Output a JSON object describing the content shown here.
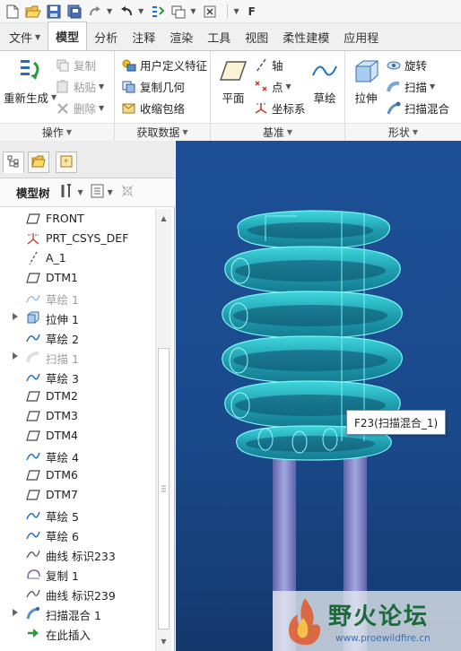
{
  "app": {
    "title_initial": "F",
    "quick_access_icons": [
      "new-icon",
      "open-icon",
      "save-icon",
      "save-copy-icon",
      "redo-icon",
      "undo-icon",
      "regenerate-icon",
      "windows-icon",
      "close-icon",
      "customize-icon"
    ]
  },
  "ribbon": {
    "tabs": [
      {
        "label": "文件",
        "dropdown": true
      },
      {
        "label": "模型",
        "active": true
      },
      {
        "label": "分析"
      },
      {
        "label": "注释"
      },
      {
        "label": "渲染"
      },
      {
        "label": "工具"
      },
      {
        "label": "视图"
      },
      {
        "label": "柔性建模"
      },
      {
        "label": "应用程"
      }
    ],
    "groups": {
      "operations": {
        "label": "操作",
        "regenerate": "重新生成",
        "copy": "复制",
        "paste": "粘贴",
        "delete": "删除"
      },
      "get_data": {
        "label": "获取数据",
        "udf": "用户定义特征",
        "copy_geom": "复制几何",
        "shrinkwrap": "收缩包络"
      },
      "datum": {
        "label": "基准",
        "plane": "平面",
        "axis": "轴",
        "point": "点",
        "csys": "坐标系",
        "sketch": "草绘"
      },
      "shapes": {
        "label": "形状",
        "extrude": "拉伸",
        "revolve": "旋转",
        "sweep": "扫描",
        "swept_blend": "扫描混合"
      }
    }
  },
  "panel": {
    "model_tree_label": "模型树",
    "items": [
      {
        "label": "FRONT",
        "icon": "datum-plane-icon",
        "expandable": false,
        "suppressed": false
      },
      {
        "label": "PRT_CSYS_DEF",
        "icon": "csys-icon",
        "expandable": false,
        "suppressed": false
      },
      {
        "label": "A_1",
        "icon": "axis-icon",
        "expandable": false,
        "suppressed": false
      },
      {
        "label": "DTM1",
        "icon": "datum-plane-icon",
        "expandable": false,
        "suppressed": false
      },
      {
        "label": "草绘 1",
        "icon": "sketch-icon",
        "expandable": false,
        "suppressed": true
      },
      {
        "label": "拉伸 1",
        "icon": "extrude-icon",
        "expandable": true,
        "suppressed": false
      },
      {
        "label": "草绘 2",
        "icon": "sketch-icon",
        "expandable": false,
        "suppressed": false
      },
      {
        "label": "扫描 1",
        "icon": "sweep-icon",
        "expandable": true,
        "suppressed": true
      },
      {
        "label": "草绘 3",
        "icon": "sketch-icon",
        "expandable": false,
        "suppressed": false
      },
      {
        "label": "DTM2",
        "icon": "datum-plane-icon",
        "expandable": false,
        "suppressed": false
      },
      {
        "label": "DTM3",
        "icon": "datum-plane-icon",
        "expandable": false,
        "suppressed": false
      },
      {
        "label": "DTM4",
        "icon": "datum-plane-icon",
        "expandable": false,
        "suppressed": false
      },
      {
        "label": "草绘 4",
        "icon": "sketch-icon",
        "expandable": false,
        "suppressed": false
      },
      {
        "label": "DTM6",
        "icon": "datum-plane-icon",
        "expandable": false,
        "suppressed": false
      },
      {
        "label": "DTM7",
        "icon": "datum-plane-icon",
        "expandable": false,
        "suppressed": false
      },
      {
        "label": "草绘 5",
        "icon": "sketch-icon",
        "expandable": false,
        "suppressed": false
      },
      {
        "label": "草绘 6",
        "icon": "sketch-icon",
        "expandable": false,
        "suppressed": false
      },
      {
        "label": "曲线 标识233",
        "icon": "curve-icon",
        "expandable": false,
        "suppressed": false
      },
      {
        "label": "复制 1",
        "icon": "copy-feature-icon",
        "expandable": false,
        "suppressed": false
      },
      {
        "label": "曲线 标识239",
        "icon": "curve-icon",
        "expandable": false,
        "suppressed": false
      },
      {
        "label": "扫描混合 1",
        "icon": "swept-blend-icon",
        "expandable": true,
        "suppressed": false
      },
      {
        "label": "在此插入",
        "icon": "insert-here-icon",
        "expandable": false,
        "suppressed": false
      }
    ]
  },
  "viewport": {
    "tooltip": "F23(扫描混合_1)",
    "watermark_logo_text": "野火论坛",
    "watermark_url": "www.proewildfire.cn",
    "model_color": "#37c8d0",
    "pipe_color": "#8a8fd0",
    "background_color": "#1a4a8c"
  },
  "colors": {
    "accent": "#1f5fae",
    "sketch_blue": "#1e6fc0"
  }
}
